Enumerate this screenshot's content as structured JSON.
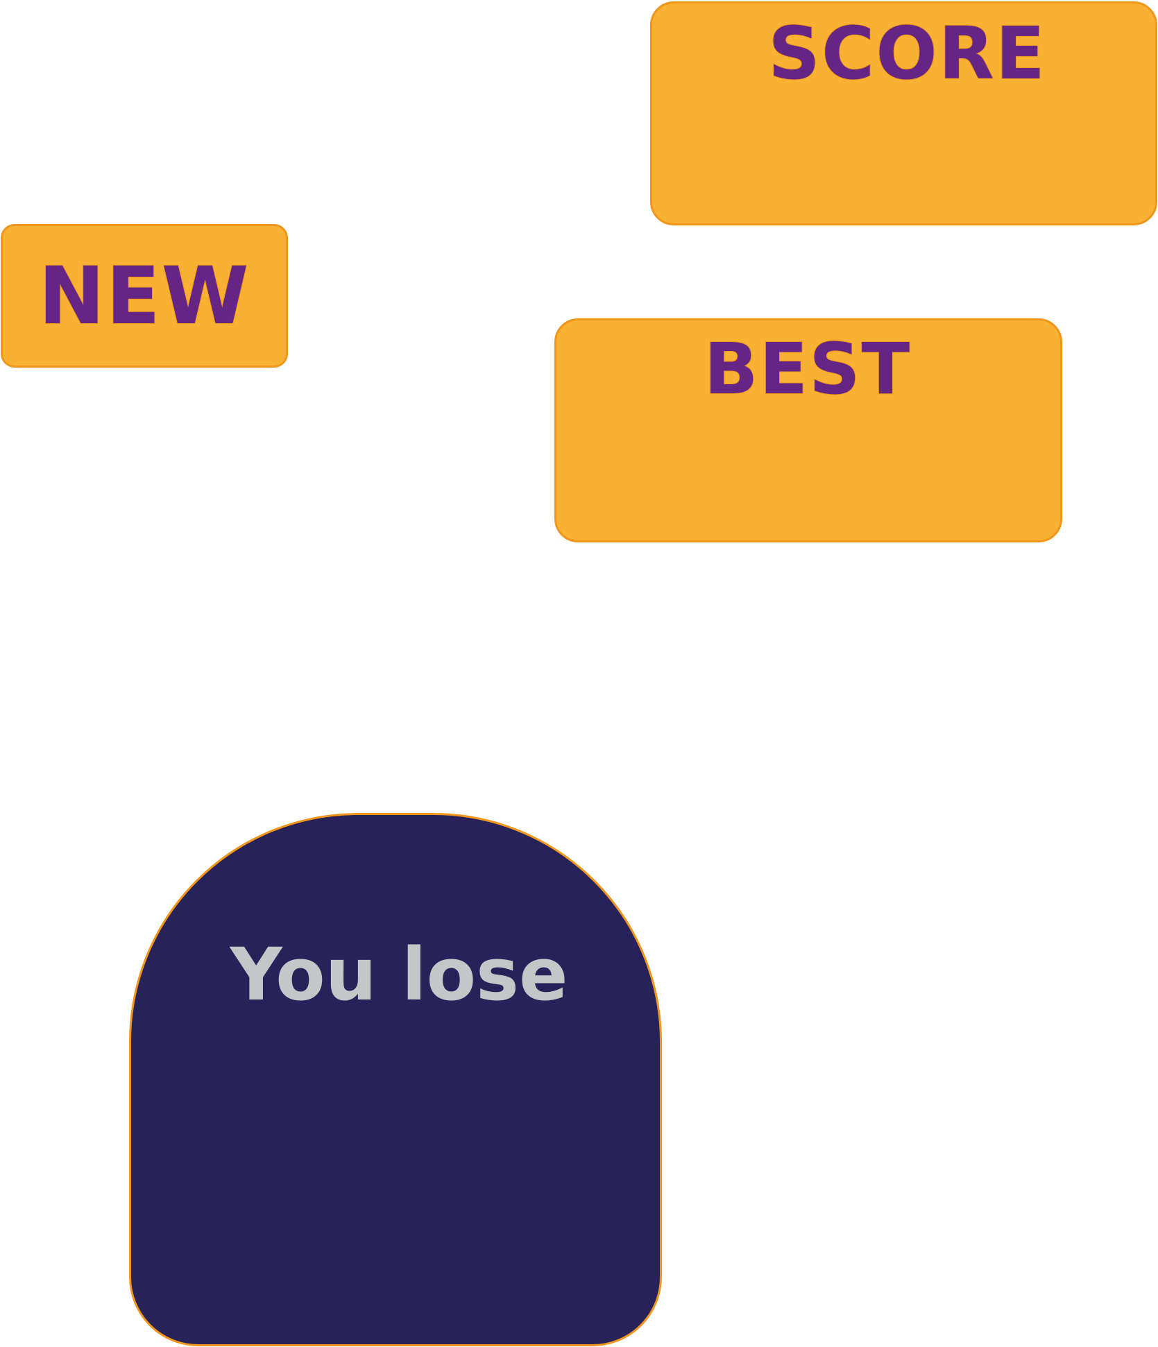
{
  "score": {
    "label": "SCORE",
    "value": ""
  },
  "best": {
    "label": "BEST",
    "value": ""
  },
  "new_game": {
    "label": "NEW"
  },
  "game_over": {
    "message": "You lose"
  },
  "colors": {
    "panel_fill": "#f8b133",
    "panel_border": "#f0961a",
    "label_text": "#652584",
    "overlay_fill": "#27235a",
    "overlay_text": "#c5c6c8",
    "background": "#ffffff"
  }
}
